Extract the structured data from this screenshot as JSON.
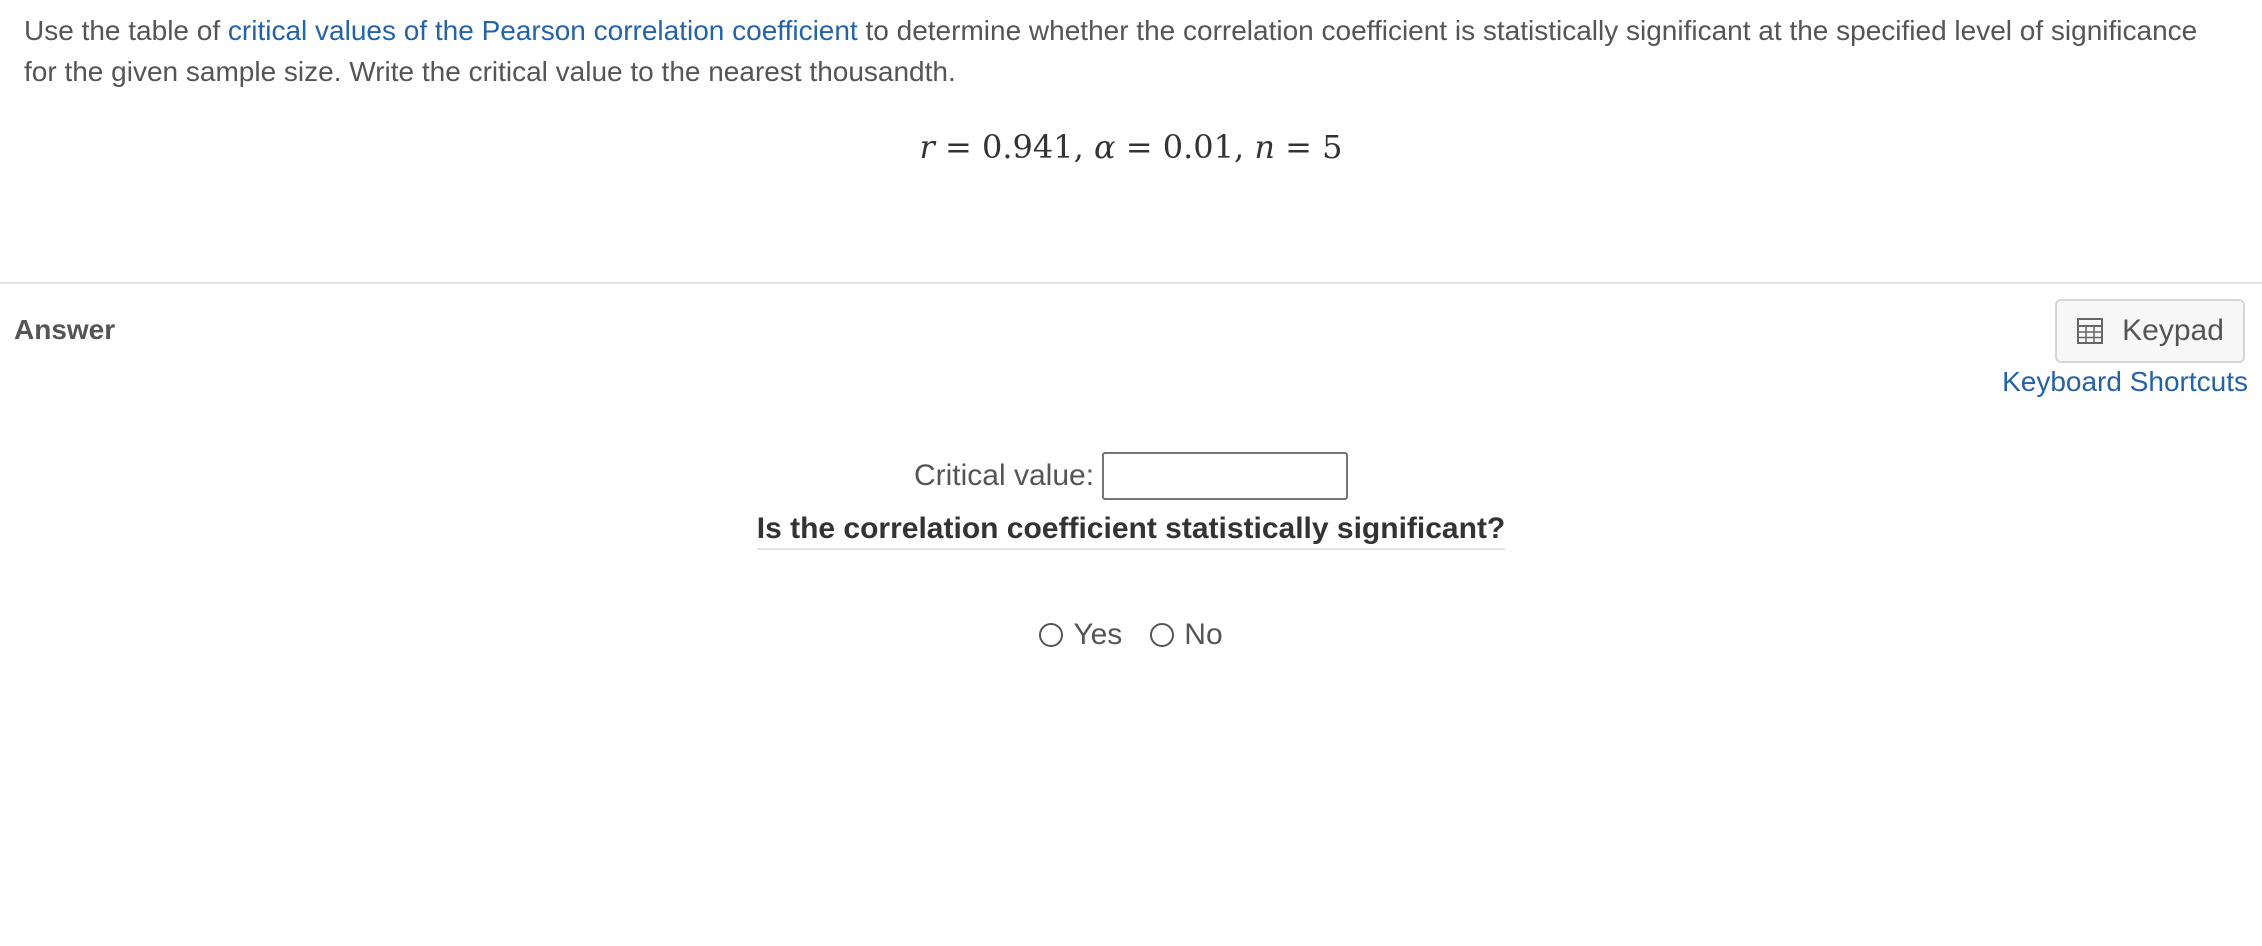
{
  "question": {
    "text_before": "Use the table of ",
    "link_text": "critical values of the Pearson correlation coefficient",
    "text_after": " to determine whether the correlation coefficient is statistically significant at the specified level of significance for the given sample size. Write the critical value to the nearest thousandth."
  },
  "formula": {
    "r_var": "r",
    "r_val": "0.941",
    "alpha_var": "α",
    "alpha_val": "0.01",
    "n_var": "n",
    "n_val": "5"
  },
  "answer": {
    "label": "Answer",
    "keypad_label": "Keypad",
    "keyboard_shortcuts": "Keyboard Shortcuts",
    "critical_value_label": "Critical value:",
    "critical_value_input": "",
    "significance_question": "Is the correlation coefficient statistically significant?",
    "options": [
      "Yes",
      "No"
    ]
  },
  "colors": {
    "link": "#2563a6",
    "text": "#555555",
    "divider": "#e2e2e2"
  }
}
